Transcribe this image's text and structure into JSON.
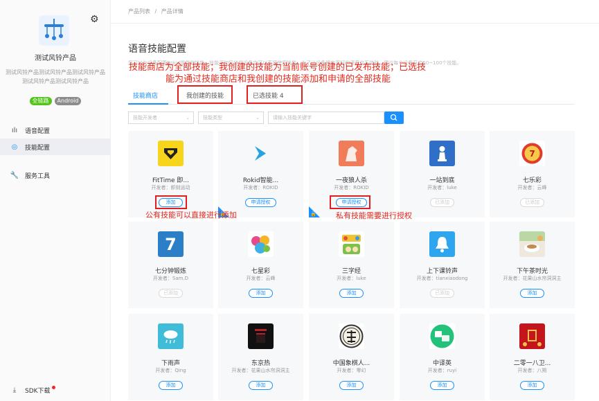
{
  "sidebar": {
    "product_name": "测试风铃产品",
    "product_desc": "测试风铃产品测试风铃产品测试风铃产品测试风铃产品测试风铃产品",
    "badges": [
      "全链路",
      "Android"
    ],
    "nav": [
      {
        "label": "语音配置",
        "icon": "waveform-icon"
      },
      {
        "label": "技能配置",
        "icon": "skill-icon"
      },
      {
        "label": "服务工具",
        "icon": "wrench-icon"
      }
    ],
    "sdk_label": "SDK下载"
  },
  "breadcrumb": [
    "产品列表",
    "/",
    "产品详情"
  ],
  "page_title": "语音技能配置",
  "intro": "您可以为设备配置Rokid提供的技能，技能添加后终端设备中可以直接使用技能，为了让设备拥有更好的语音交互体验，建议每个设备开启50~100个技能。",
  "tabs": [
    "技能商店",
    "我创建的技能",
    "已选技能 4"
  ],
  "filters": {
    "developer_placeholder": "技能开发者",
    "type_placeholder": "技能类型",
    "search_placeholder": "请输入技能关键字"
  },
  "skills": [
    {
      "name": "FitTime 即...",
      "dev": "开发者：即刻运动",
      "action": "添加",
      "state": "add"
    },
    {
      "name": "Rokid智能...",
      "dev": "开发者：ROKID",
      "action": "申请授权",
      "state": "apply"
    },
    {
      "name": "一夜狼人杀",
      "dev": "开发者：ROKID",
      "action": "申请授权",
      "state": "apply"
    },
    {
      "name": "一站到底",
      "dev": "开发者：luke",
      "action": "已添加",
      "state": "added"
    },
    {
      "name": "七乐彩",
      "dev": "开发者：云峰",
      "action": "已添加",
      "state": "added"
    },
    {
      "name": "七分钟锻炼",
      "dev": "开发者：Sam.D",
      "action": "已添加",
      "state": "added"
    },
    {
      "name": "七星彩",
      "dev": "开发者：云峰",
      "action": "添加",
      "state": "add"
    },
    {
      "name": "三字经",
      "dev": "开发者：luke",
      "action": "添加",
      "state": "add"
    },
    {
      "name": "上下课铃声",
      "dev": "开发者：tianxiaodong",
      "action": "已添加",
      "state": "added"
    },
    {
      "name": "下午茶时光",
      "dev": "开发者：花果山水帘洞洞主",
      "action": "添加",
      "state": "add"
    },
    {
      "name": "下雨声",
      "dev": "开发者：Qing",
      "action": "添加",
      "state": "add"
    },
    {
      "name": "东京热",
      "dev": "开发者：花果山水帘洞洞主",
      "action": "添加",
      "state": "add"
    },
    {
      "name": "中国象棋人...",
      "dev": "开发者：零幻",
      "action": "添加",
      "state": "add"
    },
    {
      "name": "中译英",
      "dev": "开发者：ruyi",
      "action": "添加",
      "state": "add"
    },
    {
      "name": "二零一八卫...",
      "dev": "开发者：八朔",
      "action": "添加",
      "state": "add"
    }
  ],
  "annotations": {
    "main_line1": "技能商店为全部技能；我创建的技能为当前账号创建的已发布技能；已选技",
    "main_line2": "能为通过技能商店和我创建的技能添加和申请的全部技能",
    "public_note": "公有技能可以直接进行添加",
    "private_note": "私有技能需要进行授权"
  },
  "colors": {
    "accent": "#1890ff",
    "annotation": "#e8261a"
  }
}
